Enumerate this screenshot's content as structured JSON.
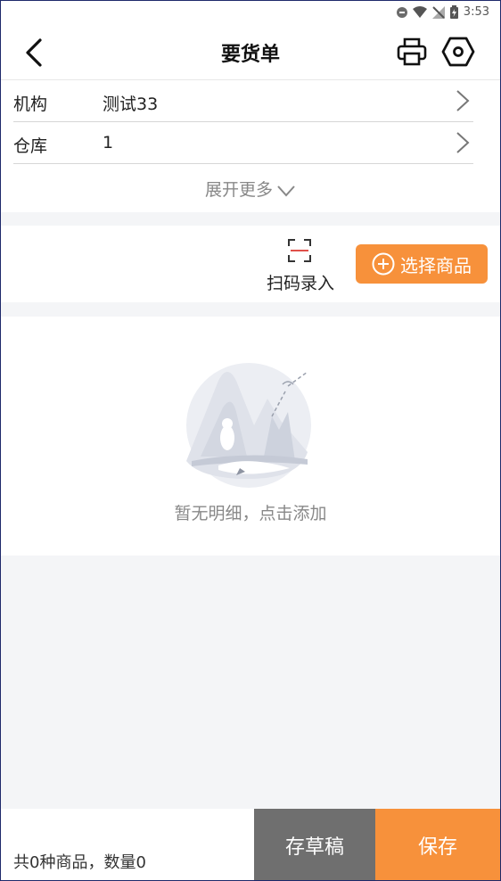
{
  "statusbar": {
    "time": "3:53"
  },
  "header": {
    "title": "要货单"
  },
  "form": {
    "rows": [
      {
        "label": "机构",
        "value": "测试33"
      },
      {
        "label": "仓库",
        "value": "1"
      }
    ],
    "expand_label": "展开更多"
  },
  "actions": {
    "scan_label": "扫码录入",
    "select_label": "选择商品"
  },
  "empty": {
    "message": "暂无明细，点击添加"
  },
  "footer": {
    "summary": "共0种商品，数量0",
    "draft_label": "存草稿",
    "save_label": "保存"
  },
  "colors": {
    "accent": "#f7913b",
    "draft": "#6f6f6f",
    "background": "#f4f5f7"
  }
}
